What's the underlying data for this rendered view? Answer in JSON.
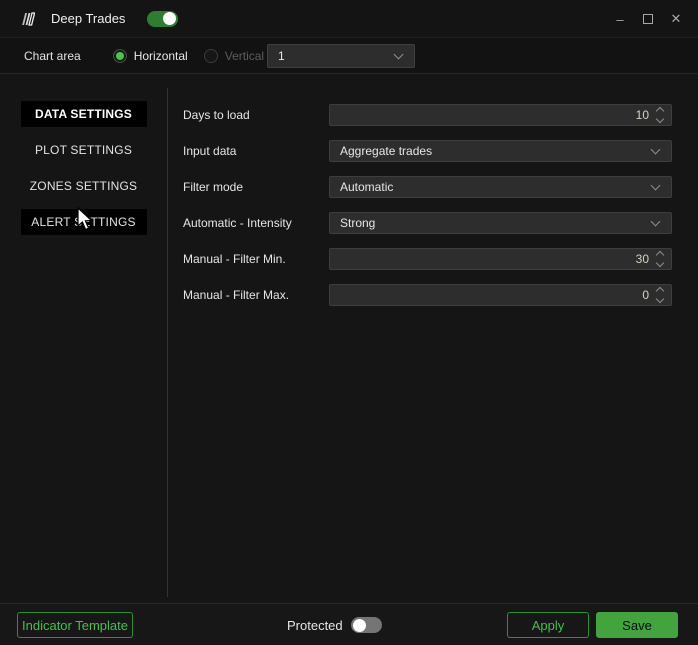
{
  "window": {
    "title": "Deep Trades",
    "enabled_toggle_on": true,
    "controls": {
      "minimize": "–",
      "close": "✕"
    }
  },
  "chart_area": {
    "label": "Chart area",
    "radio_horizontal": "Horizontal",
    "radio_vertical": "Vertical",
    "selected_orientation": "Horizontal",
    "chart_number": "1"
  },
  "sidebar": {
    "items": [
      {
        "label": "DATA SETTINGS",
        "state": "active"
      },
      {
        "label": "PLOT SETTINGS",
        "state": "normal"
      },
      {
        "label": "ZONES SETTINGS",
        "state": "normal"
      },
      {
        "label": "ALERT SETTINGS",
        "state": "hovered"
      }
    ]
  },
  "form": {
    "fields": [
      {
        "label": "Days to load",
        "type": "number",
        "value": "10"
      },
      {
        "label": "Input data",
        "type": "select",
        "value": "Aggregate trades"
      },
      {
        "label": "Filter mode",
        "type": "select",
        "value": "Automatic"
      },
      {
        "label": "Automatic - Intensity",
        "type": "select",
        "value": "Strong"
      },
      {
        "label": "Manual - Filter Min.",
        "type": "number",
        "value": "30"
      },
      {
        "label": "Manual - Filter Max.",
        "type": "number",
        "value": "0"
      }
    ]
  },
  "footer": {
    "indicator_template_label": "Indicator Template",
    "protected_label": "Protected",
    "protected_toggle_on": false,
    "apply_label": "Apply",
    "save_label": "Save"
  },
  "colors": {
    "accent_green": "#3fae46",
    "toggle_on_green": "#2e7d32",
    "save_button_bg": "#43a33f",
    "radio_selected_green": "#45c945",
    "number_value_text": "#d9d2c0",
    "field_background": "#2d2d2d",
    "window_background": "#151515"
  }
}
